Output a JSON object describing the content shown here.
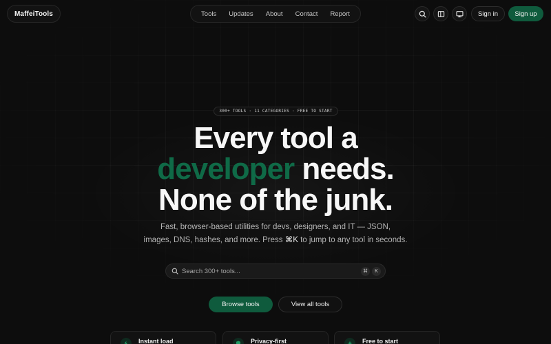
{
  "header": {
    "logo": "MaffeiTools",
    "nav": [
      {
        "label": "Tools"
      },
      {
        "label": "Updates"
      },
      {
        "label": "About"
      },
      {
        "label": "Contact"
      },
      {
        "label": "Report"
      }
    ],
    "icons": [
      "search-icon",
      "sidebar-icon",
      "monitor-icon"
    ],
    "sign_in": "Sign in",
    "sign_up": "Sign up"
  },
  "hero": {
    "badge": "300+ TOOLS · 11 CATEGORIES · FREE TO START",
    "headline_line1": "Every tool a",
    "headline_accent": "developer",
    "headline_line2_rest": " needs.",
    "headline_line3": "None of the junk.",
    "sub_line1": "Fast, browser-based utilities for devs, designers, and IT — JSON,",
    "sub_line2_a": "images, DNS, hashes, and more. Press ",
    "sub_line2_key": "⌘K",
    "sub_line2_b": " to jump to any tool in seconds.",
    "search_placeholder": "Search 300+ tools...",
    "search_kbd": [
      "⌘",
      "K"
    ],
    "primary_button": "Browse tools",
    "secondary_button": "View all tools"
  },
  "features": [
    {
      "label": "Instant load",
      "icon": "lightning-icon"
    },
    {
      "label": "Privacy-first",
      "icon": "shield-icon"
    },
    {
      "label": "Free to start",
      "icon": "sparkle-icon"
    }
  ],
  "colors": {
    "background": "#0d0d0d",
    "accent": "#0f5b3d",
    "accent_text": "#0f6a47"
  }
}
